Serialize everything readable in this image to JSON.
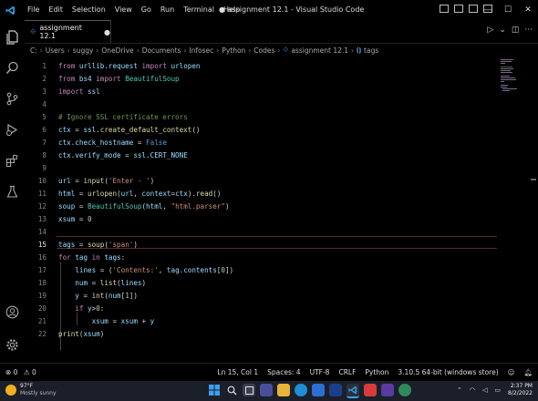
{
  "titlebar": {
    "menu": [
      "File",
      "Edit",
      "Selection",
      "View",
      "Go",
      "Run",
      "Terminal",
      "Help"
    ],
    "window_title": "● assignment 12.1 - Visual Studio Code",
    "controls": {
      "minimize": "—",
      "maximize": "☐",
      "close": "✕"
    }
  },
  "tab": {
    "icon": "py",
    "name": "assignment 12.1",
    "modified": "●"
  },
  "tab_actions": {
    "run": "▷",
    "run_menu": "⌄",
    "split": "◫",
    "more": "···"
  },
  "breadcrumb": [
    "C:",
    "Users",
    "suggy",
    "OneDrive",
    "Documents",
    "Infosec",
    "Python",
    "Codes",
    "assignment 12.1",
    "tags"
  ],
  "code_lines": [
    {
      "n": "1",
      "text": "from urllib.request import urlopen"
    },
    {
      "n": "2",
      "text": "from bs4 import BeautifulSoup"
    },
    {
      "n": "3",
      "text": "import ssl"
    },
    {
      "n": "4",
      "text": ""
    },
    {
      "n": "5",
      "text": "# Ignore SSL certificate errors"
    },
    {
      "n": "6",
      "text": "ctx = ssl.create_default_context()"
    },
    {
      "n": "7",
      "text": "ctx.check_hostname = False"
    },
    {
      "n": "8",
      "text": "ctx.verify_mode = ssl.CERT_NONE"
    },
    {
      "n": "9",
      "text": ""
    },
    {
      "n": "10",
      "text": "url = input('Enter - ')"
    },
    {
      "n": "11",
      "text": "html = urlopen(url, context=ctx).read()"
    },
    {
      "n": "12",
      "text": "soup = BeautifulSoup(html, \"html.parser\")"
    },
    {
      "n": "13",
      "text": "xsum = 0"
    },
    {
      "n": "14",
      "text": ""
    },
    {
      "n": "15",
      "text": "tags = soup('span')"
    },
    {
      "n": "16",
      "text": "for tag in tags:"
    },
    {
      "n": "17",
      "text": "    lines = ('Contents:', tag.contents[0])"
    },
    {
      "n": "18",
      "text": "    num = list(lines)"
    },
    {
      "n": "19",
      "text": "    y = int(num[1])"
    },
    {
      "n": "20",
      "text": "    if y>0:"
    },
    {
      "n": "21",
      "text": "        xsum = xsum + y"
    },
    {
      "n": "22",
      "text": "print(xsum)"
    }
  ],
  "current_line": "15",
  "status": {
    "errors": "⊗ 0",
    "warnings": "⚠ 0",
    "position": "Ln 15, Col 1",
    "spaces": "Spaces: 4",
    "encoding": "UTF-8",
    "eol": "CRLF",
    "language": "Python",
    "interpreter": "3.10.5 64-bit (windows store)"
  },
  "taskbar": {
    "weather_temp": "97°F",
    "weather_desc": "Mostly sunny",
    "time": "2:37 PM",
    "date": "8/2/2022"
  },
  "colors": {
    "accent": "#007acc",
    "keyword": "#c586c0",
    "string": "#ce9178",
    "comment": "#6a9955",
    "function": "#dcdcaa",
    "number": "#b5cea8"
  }
}
